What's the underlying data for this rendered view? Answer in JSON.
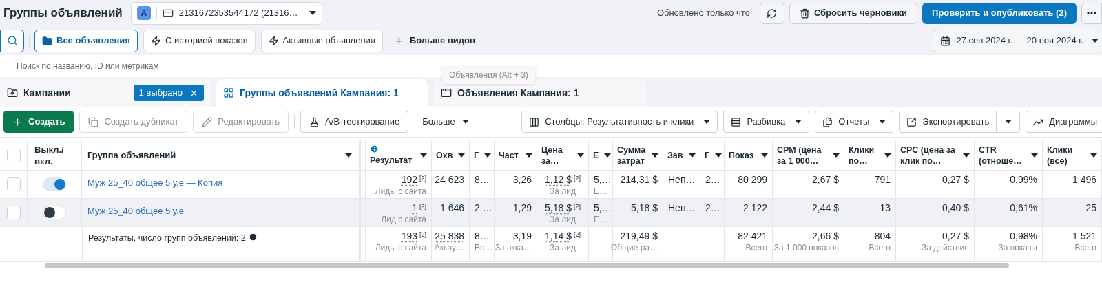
{
  "header": {
    "title": "Группы объявлений",
    "account": {
      "badge": "A",
      "label": "2131672353544172 (21316…"
    },
    "status": "Обновлено только что",
    "buttons": [
      {
        "label": "Сбросить черновики",
        "kind": "secondary"
      },
      {
        "label": "Проверить и опубликовать (2)",
        "kind": "primary"
      }
    ]
  },
  "views": [
    {
      "label": "Все объявления",
      "selected": true
    },
    {
      "label": "С историей показов",
      "selected": false
    },
    {
      "label": "Активные объявления",
      "selected": false
    }
  ],
  "more_views": "Больше видов",
  "date_range": "27 сен 2024 г. — 20 ноя 2024 г.",
  "search": {
    "placeholder": "Поиск по названию, ID или метрикам"
  },
  "tooltip": "Объявления (Alt + 3)",
  "tabs": [
    {
      "label": "Кампании",
      "selected": false,
      "badge": "1 выбрано"
    },
    {
      "label": "Группы объявлений Кампания: 1",
      "selected": true
    },
    {
      "label": "Объявления Кампания: 1",
      "selected": false
    }
  ],
  "toolbar": {
    "left": [
      {
        "label": "Создать",
        "kind": "primary"
      },
      {
        "label": "Создать дубликат",
        "kind": "disabled"
      },
      {
        "label": "Редактировать",
        "kind": "disabled"
      },
      {
        "label": "A/B-тестирование",
        "kind": "normal"
      },
      {
        "label": "Больше",
        "kind": "menu"
      }
    ],
    "right": [
      {
        "label": "Столбцы: Результативность и клики",
        "kind": "dropdown"
      },
      {
        "label": "Разбивка",
        "kind": "dropdown"
      },
      {
        "label": "Отчеты",
        "kind": "dropdown"
      },
      {
        "label": "Экспортировать",
        "kind": "split"
      },
      {
        "label": "Диаграммы",
        "kind": "normal"
      }
    ]
  },
  "table": {
    "select_all": {
      "checked": false
    },
    "toggle_header": "Выкл./вкл.",
    "name_header": "Группа объявлений",
    "columns": [
      {
        "label": "Результат",
        "info": true
      },
      {
        "label": "Охв",
        "info": false
      },
      {
        "label": "Г",
        "info": false
      },
      {
        "label": "Част",
        "info": false
      },
      {
        "label": "Цена за…",
        "info": false
      },
      {
        "label": "Е",
        "info": false
      },
      {
        "label": "Сумма затрат",
        "info": false
      },
      {
        "label": "Зав",
        "info": false
      },
      {
        "label": "Г",
        "info": false
      },
      {
        "label": "Показ",
        "info": false
      },
      {
        "label": "CPM (цена за 1 000…",
        "info": false
      },
      {
        "label": "Клики по…",
        "info": false
      },
      {
        "label": "CPC (цена за клик по…",
        "info": false
      },
      {
        "label": "CTR (отноше…",
        "info": false
      },
      {
        "label": "Клики (все)",
        "info": false
      }
    ],
    "rows": [
      {
        "name": "Муж 25_40 общее 5 у.е — Копия",
        "on": true,
        "checked": false,
        "hovered": false,
        "cells": [
          {
            "value": "192",
            "note": "[2]",
            "sub": "Лиды с сайта",
            "dotted": true
          },
          {
            "value": "24 623"
          },
          {
            "value": "8…"
          },
          {
            "value": "3,26"
          },
          {
            "value": "1,12 $",
            "note": "[2]",
            "sub": "За лид",
            "dotted": true
          },
          {
            "value": "5,…",
            "sub": "Е…"
          },
          {
            "value": "214,31 $"
          },
          {
            "value": "Неп…"
          },
          {
            "value": "2…"
          },
          {
            "value": "80 299"
          },
          {
            "value": "2,67 $"
          },
          {
            "value": "791"
          },
          {
            "value": "0,27 $"
          },
          {
            "value": "0,99%"
          },
          {
            "value": "1 496"
          }
        ]
      },
      {
        "name": "Муж 25_40 общее 5 у.е",
        "on": false,
        "checked": false,
        "hovered": true,
        "cells": [
          {
            "value": "1",
            "note": "[2]",
            "sub": "Лид с сайта",
            "dotted": true
          },
          {
            "value": "1 646"
          },
          {
            "value": "2 …"
          },
          {
            "value": "1,29"
          },
          {
            "value": "5,18 $",
            "note": "[2]",
            "sub": "За лид",
            "dotted": true
          },
          {
            "value": "5,…",
            "sub": "Е…"
          },
          {
            "value": "5,18 $"
          },
          {
            "value": "Неп…"
          },
          {
            "value": "2…"
          },
          {
            "value": "2 122"
          },
          {
            "value": "2,44 $"
          },
          {
            "value": "13"
          },
          {
            "value": "0,40 $"
          },
          {
            "value": "0,61%"
          },
          {
            "value": "25"
          }
        ]
      }
    ],
    "totals": {
      "label": "Результаты, число групп объявлений: 2",
      "cells": [
        {
          "value": "193",
          "note": "[2]",
          "sub": "Лиды с сайта",
          "dotted": true
        },
        {
          "value": "25 838",
          "sub": "Аккау…",
          "dotted": true
        },
        {
          "value": "8…",
          "sub": "Вс…"
        },
        {
          "value": "3,19",
          "sub": "За акка…"
        },
        {
          "value": "1,14 $",
          "note": "[2]",
          "sub": "За лид",
          "dotted": true
        },
        null,
        {
          "value": "219,49 $",
          "sub": "Общие ра…"
        },
        null,
        null,
        {
          "value": "82 421",
          "sub": "Всего"
        },
        {
          "value": "2,66 $",
          "sub": "За 1 000 показов"
        },
        {
          "value": "804",
          "sub": "Всего"
        },
        {
          "value": "0,27 $",
          "sub": "За действие"
        },
        {
          "value": "0,98%",
          "sub": "За показы"
        },
        {
          "value": "1 521",
          "sub": "Всего"
        }
      ]
    }
  }
}
